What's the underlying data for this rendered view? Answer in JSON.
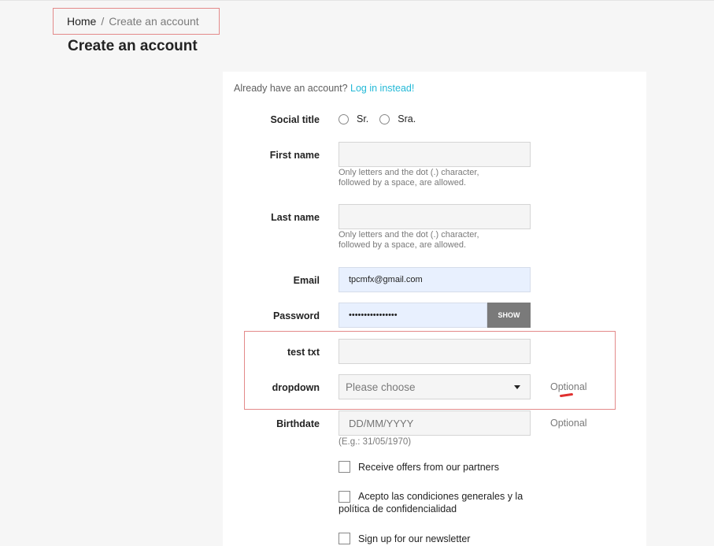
{
  "breadcrumb": {
    "home": "Home",
    "separator": "/",
    "current": "Create an account"
  },
  "page_title": "Create an account",
  "login_prompt": {
    "text": "Already have an account?",
    "link": "Log in instead!"
  },
  "form": {
    "social_title": {
      "label": "Social title",
      "options": [
        "Sr.",
        "Sra."
      ]
    },
    "first_name": {
      "label": "First name",
      "value": "",
      "hint_line1": "Only letters and the dot (.) character,",
      "hint_line2": "followed by a space, are allowed."
    },
    "last_name": {
      "label": "Last name",
      "value": "",
      "hint_line1": "Only letters and the dot (.) character,",
      "hint_line2": "followed by a space, are allowed."
    },
    "email": {
      "label": "Email",
      "value": "tpcmfx@gmail.com"
    },
    "password": {
      "label": "Password",
      "value": "••••••••••••••••",
      "show_label": "SHOW"
    },
    "test_txt": {
      "label": "test txt",
      "value": ""
    },
    "dropdown": {
      "label": "dropdown",
      "selected": "Please choose",
      "optional": "Optional"
    },
    "birthdate": {
      "label": "Birthdate",
      "placeholder": "DD/MM/YYYY",
      "hint": "(E.g.: 31/05/1970)",
      "optional": "Optional"
    },
    "checkboxes": {
      "partners": "Receive offers from our partners",
      "terms_line1": "Acepto las condiciones generales y la",
      "terms_line2": "política de confidencialidad",
      "newsletter": "Sign up for our newsletter"
    }
  },
  "colors": {
    "link": "#24b9d7",
    "highlight": "#e38a8a",
    "annotation": "#e0302f"
  }
}
